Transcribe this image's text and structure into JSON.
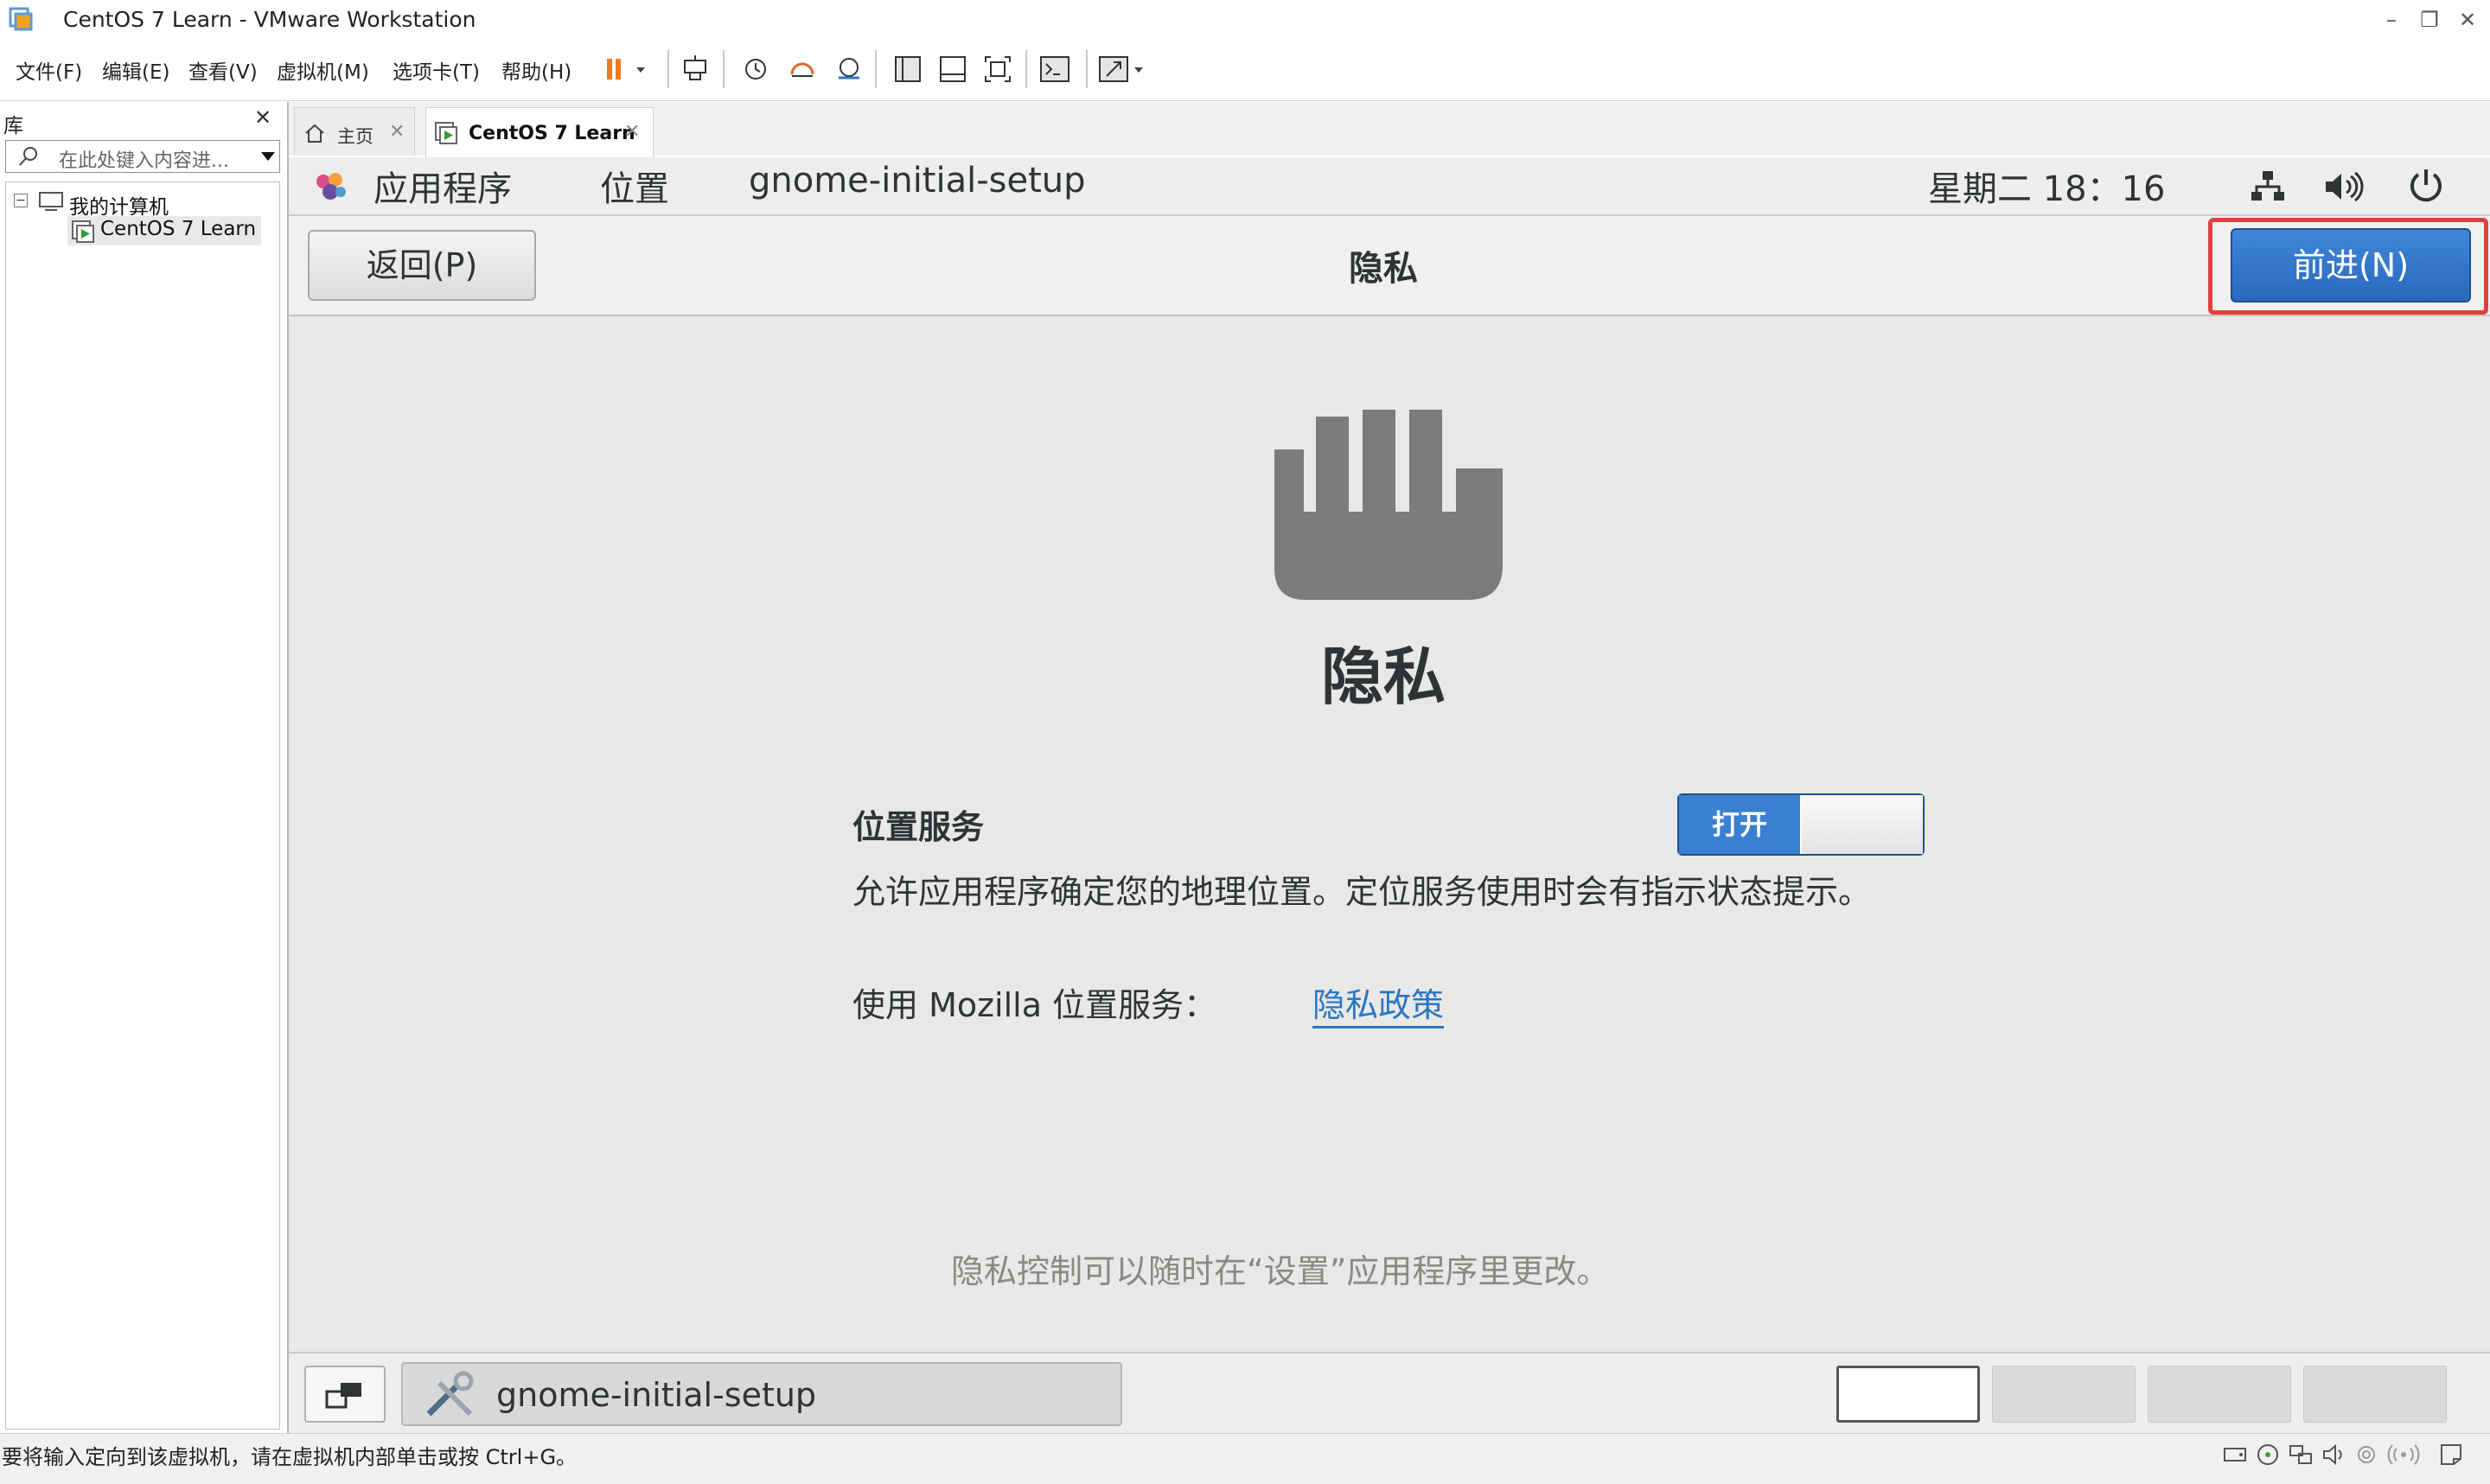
{
  "window": {
    "title": "CentOS 7 Learn - VMware Workstation",
    "minimize": "–",
    "restore": "❐",
    "close": "✕"
  },
  "menu": [
    "文件(F)",
    "编辑(E)",
    "查看(V)",
    "虚拟机(M)",
    "选项卡(T)",
    "帮助(H)"
  ],
  "library": {
    "title": "库",
    "close": "✕",
    "search_placeholder": "在此处键入内容进...",
    "tree": {
      "root_expander": "−",
      "root_label": "我的计算机",
      "vm_label": "CentOS 7 Learn"
    }
  },
  "tabs": [
    {
      "label": "主页",
      "close": "✕"
    },
    {
      "label": "CentOS 7 Learn",
      "close": "✕"
    }
  ],
  "gnome": {
    "apps_menu": "应用程序",
    "places_menu": "位置",
    "window_name": "gnome-initial-setup",
    "clock": "星期二 18：16"
  },
  "setup": {
    "back_button": "返回(P)",
    "header_title": "隐私",
    "next_button": "前进(N)",
    "page_title": "隐私",
    "location_label": "位置服务",
    "toggle_on_label": "打开",
    "description": "允许应用程序确定您的地理位置。定位服务使用时会有指示状态提示。",
    "mozilla_text": "使用 Mozilla 位置服务：",
    "privacy_link": "隐私政策",
    "footer_note": "隐私控制可以随时在“设置”应用程序里更改。"
  },
  "taskbar": {
    "task_label": "gnome-initial-setup"
  },
  "statusbar": {
    "text": "要将输入定向到该虚拟机，请在虚拟机内部单击或按 Ctrl+G。"
  },
  "colors": {
    "accent_blue": "#3b7fd1",
    "highlight_red": "#e53e3e",
    "link_blue": "#2a76c6",
    "pause_orange": "#f07b1d"
  }
}
